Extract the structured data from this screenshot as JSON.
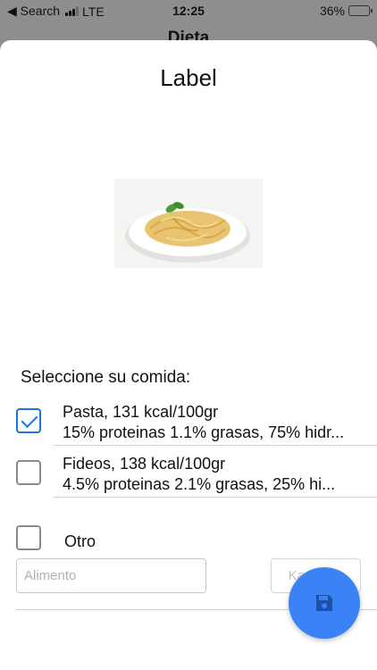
{
  "status_bar": {
    "back_label": "◀ Search",
    "network": "LTE",
    "time": "12:25",
    "battery": "36%",
    "battery_level": 0.36,
    "battery_color": "#f5c400"
  },
  "background_screen": {
    "title": "Dieta"
  },
  "sheet": {
    "title": "Label",
    "image_icon": "pasta-dish-photo",
    "prompt": "Seleccione su comida:",
    "options": [
      {
        "line1": "Pasta, 131 kcal/100gr",
        "line2": "15% proteinas 1.1% grasas, 75% hidr...",
        "checked": true
      },
      {
        "line1": "Fideos, 138 kcal/100gr",
        "line2": "4.5% proteinas 2.1% grasas, 25% hi...",
        "checked": false
      }
    ],
    "other": {
      "label": "Otro",
      "checked": false
    },
    "food_input": {
      "placeholder": "Alimento",
      "value": ""
    },
    "add_button_label": "Kagregar"
  },
  "fab": {
    "icon": "save-icon",
    "color": "#3b82f6"
  },
  "colors": {
    "accent": "#1a73e8"
  }
}
